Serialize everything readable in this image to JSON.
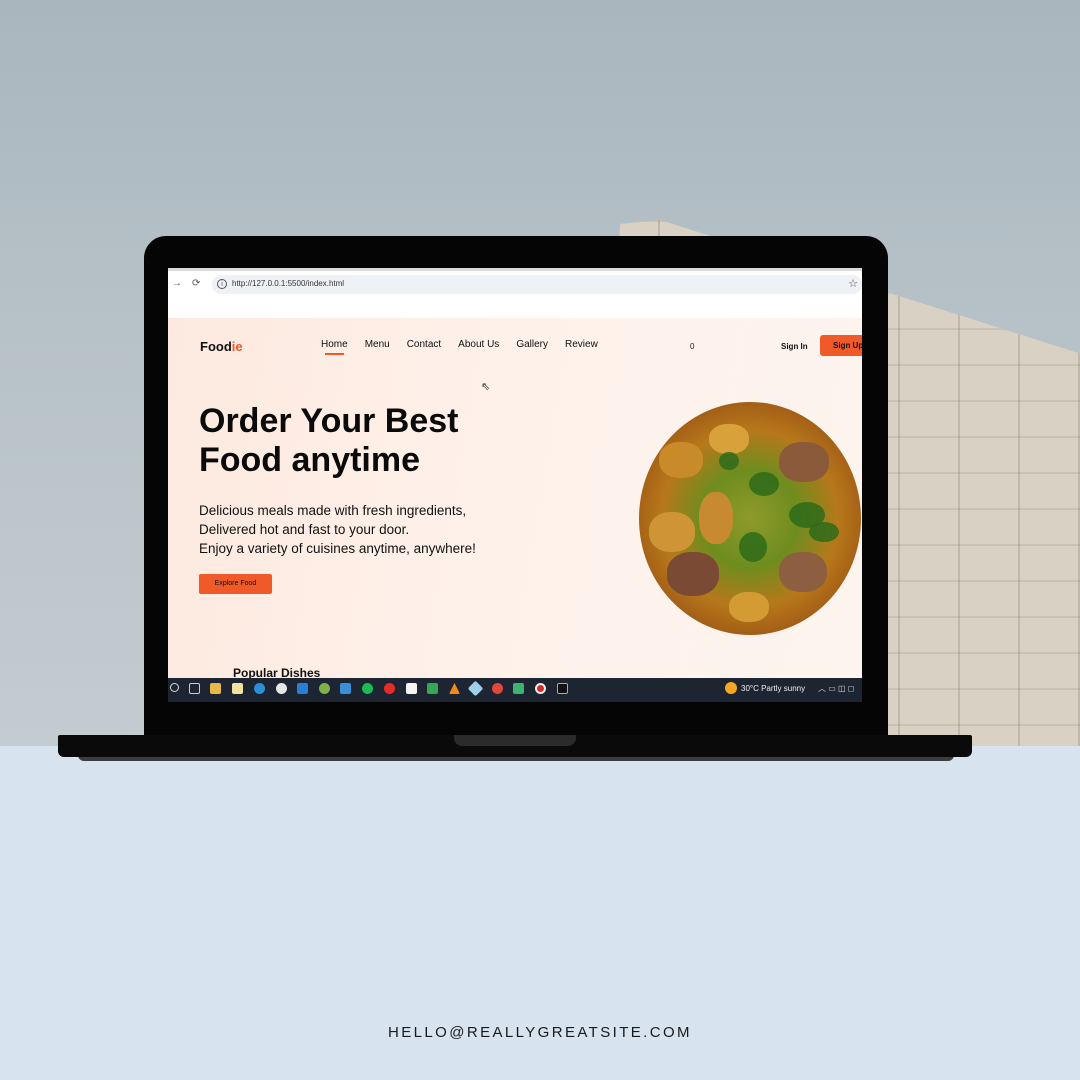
{
  "browser": {
    "url": "http://127.0.0.1:5500/index.html",
    "forward_icon": "→",
    "reload_icon": "⟳",
    "info_icon": "i",
    "star_icon": "☆"
  },
  "site": {
    "logo_main": "Food",
    "logo_accent": "ie",
    "nav": [
      "Home",
      "Menu",
      "Contact",
      "About Us",
      "Gallery",
      "Review"
    ],
    "active_nav": "Home",
    "cart_count": "0",
    "sign_in": "Sign In",
    "sign_up": "Sign Up",
    "hero_title": "Order Your Best Food anytime",
    "hero_lines": [
      "Delicious meals made with fresh ingredients,",
      "Delivered hot and fast to your door.",
      "Enjoy a variety of cuisines anytime, anywhere!"
    ],
    "explore_button": "Explore Food",
    "popular_heading": "Popular Dishes"
  },
  "taskbar": {
    "weather": "30°C  Partly sunny",
    "icons": [
      "search-icon",
      "task-view-icon",
      "file-explorer-icon",
      "calendar-icon",
      "edge-icon",
      "chrome-icon",
      "vscode-icon",
      "chrome-profile-icon",
      "mail-icon",
      "spotify-icon",
      "youtube-icon",
      "notepad-icon",
      "drive-icon",
      "vlc-icon",
      "app-icon",
      "pdf-icon",
      "app-green-icon",
      "record-icon",
      "tiktok-icon"
    ],
    "tray": "︿ ▭ ◫ ◻"
  },
  "colors": {
    "accent": "#f05a28",
    "lower_panel": "#d7e3ee"
  },
  "footer": {
    "email": "HELLO@REALLYGREATSITE.COM"
  }
}
